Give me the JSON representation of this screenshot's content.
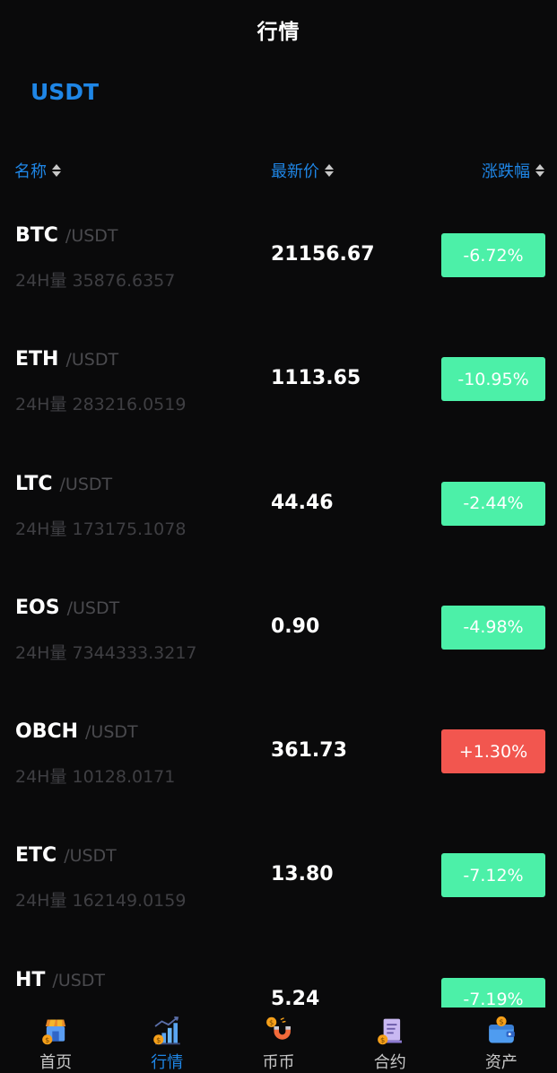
{
  "header": {
    "title": "行情"
  },
  "tabs": {
    "active_label": "USDT"
  },
  "columns": {
    "name": "名称",
    "price": "最新价",
    "change": "涨跌幅"
  },
  "colors": {
    "accent": "#1f86e6",
    "down": "#4cf0a8",
    "up": "#f2564f",
    "background": "#0a0a0b"
  },
  "rows": [
    {
      "base": "BTC",
      "quote": "/USDT",
      "volume": "24H量 35876.6357",
      "price": "21156.67",
      "change": "-6.72%",
      "direction": "down"
    },
    {
      "base": "ETH",
      "quote": "/USDT",
      "volume": "24H量 283216.0519",
      "price": "1113.65",
      "change": "-10.95%",
      "direction": "down"
    },
    {
      "base": "LTC",
      "quote": "/USDT",
      "volume": "24H量 173175.1078",
      "price": "44.46",
      "change": "-2.44%",
      "direction": "down"
    },
    {
      "base": "EOS",
      "quote": "/USDT",
      "volume": "24H量 7344333.3217",
      "price": "0.90",
      "change": "-4.98%",
      "direction": "down"
    },
    {
      "base": "OBCH",
      "quote": "/USDT",
      "volume": "24H量 10128.0171",
      "price": "361.73",
      "change": "+1.30%",
      "direction": "up"
    },
    {
      "base": "ETC",
      "quote": "/USDT",
      "volume": "24H量 162149.0159",
      "price": "13.80",
      "change": "-7.12%",
      "direction": "down"
    },
    {
      "base": "HT",
      "quote": "/USDT",
      "volume": "",
      "price": "5.24",
      "change": "-7.19%",
      "direction": "down"
    }
  ],
  "tabbar": {
    "active": "market",
    "items": [
      {
        "label": "首页",
        "icon": "home-shop-icon"
      },
      {
        "label": "行情",
        "icon": "market-chart-icon"
      },
      {
        "label": "币币",
        "icon": "exchange-magnet-icon"
      },
      {
        "label": "合约",
        "icon": "contract-document-icon"
      },
      {
        "label": "资产",
        "icon": "wallet-icon"
      }
    ]
  }
}
